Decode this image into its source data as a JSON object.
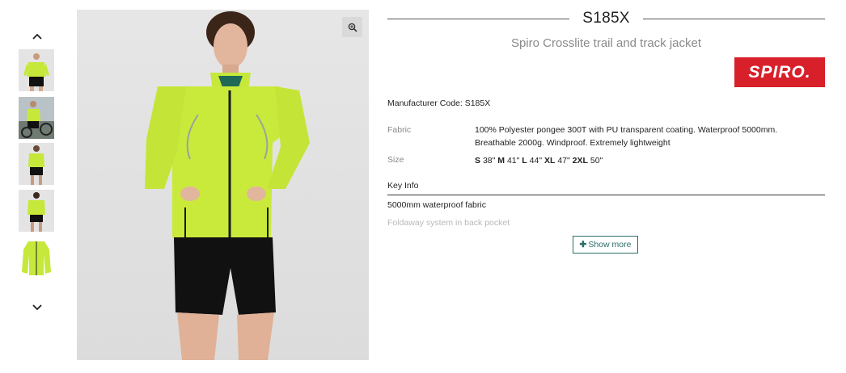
{
  "product": {
    "code": "S185X",
    "name": "Spiro Crosslite trail and track jacket",
    "brand_logo_text": "SPIRO.",
    "brand_color": "#d8202a",
    "manufacturer_code_label": "Manufacturer Code: S185X"
  },
  "gallery": {
    "up_icon": "chevron-up-icon",
    "down_icon": "chevron-down-icon",
    "zoom_icon": "magnifier-zoom-icon",
    "thumbnails": [
      "front view",
      "cyclist outdoor",
      "front full",
      "back view",
      "jacket flat"
    ]
  },
  "specs": {
    "fabric_label": "Fabric",
    "fabric_value": "100% Polyester pongee 300T with PU transparent coating. Waterproof 5000mm. Breathable 2000g. Windproof. Extremely lightweight",
    "size_label": "Size",
    "sizes": [
      {
        "size": "S",
        "chest": "38\""
      },
      {
        "size": "M",
        "chest": "41\""
      },
      {
        "size": "L",
        "chest": "44\""
      },
      {
        "size": "XL",
        "chest": "47\""
      },
      {
        "size": "2XL",
        "chest": "50\""
      }
    ]
  },
  "key_info": {
    "heading": "Key Info",
    "items": [
      "5000mm waterproof fabric",
      "Foldaway system in back pocket"
    ],
    "show_more_label": "Show more",
    "accent": "#2b6e6a"
  }
}
